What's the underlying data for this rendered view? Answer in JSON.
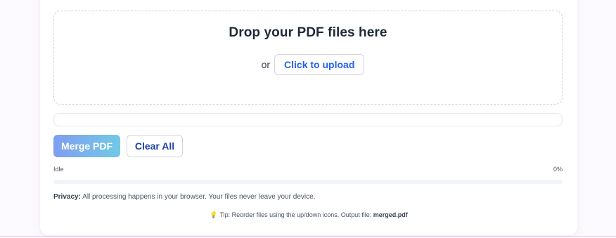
{
  "dropzone": {
    "title": "Drop your PDF files here",
    "or_text": "or",
    "upload_label": "Click to upload"
  },
  "actions": {
    "merge_label": "Merge PDF",
    "clear_label": "Clear All"
  },
  "status": {
    "state": "Idle",
    "percent_text": "0%",
    "progress_fraction": 0
  },
  "privacy": {
    "label": "Privacy:",
    "text": " All processing happens in your browser. Your files never leave your device."
  },
  "tip": {
    "icon": "lightbulb-icon",
    "text": "Tip: Reorder files using the up/down icons. Output file: ",
    "filename": "merged.pdf"
  },
  "colors": {
    "accent": "#2563eb",
    "merge_gradient_start": "#7f9ef0",
    "merge_gradient_end": "#72c9e6",
    "page_background": "#fcfaff"
  }
}
